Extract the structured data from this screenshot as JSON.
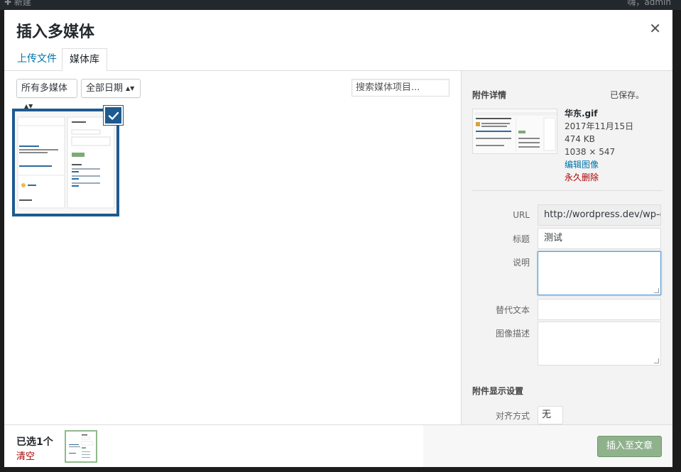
{
  "topbar": {
    "left": "✚ 新建",
    "right": "嗨，admin"
  },
  "modal": {
    "title": "插入多媒体",
    "close_icon": "close-icon"
  },
  "tabs": [
    {
      "label": "上传文件",
      "active": false
    },
    {
      "label": "媒体库",
      "active": true
    }
  ],
  "toolbar": {
    "type_filter": "所有多媒体",
    "date_filter": "全部日期",
    "search_placeholder": "搜索媒体项目..."
  },
  "attachment": {
    "selected": true,
    "check_icon": "checkmark-icon"
  },
  "details": {
    "heading": "附件详情",
    "saved": "已保存。",
    "filename": "华东.gif",
    "date": "2017年11月15日",
    "size": "474 KB",
    "dimensions": "1038 × 547",
    "edit_link": "编辑图像",
    "delete_link": "永久删除",
    "fields": {
      "url_label": "URL",
      "url_value": "http://wordpress.dev/wp-cc",
      "title_label": "标题",
      "title_value": "测试",
      "caption_label": "说明",
      "caption_value": "",
      "alt_label": "替代文本",
      "alt_value": "",
      "description_label": "图像描述",
      "description_value": ""
    },
    "display_heading": "附件显示设置",
    "align_label": "对齐方式",
    "align_value": "无"
  },
  "footer": {
    "selected_count": "已选1个",
    "clear": "清空",
    "insert_button": "插入至文章"
  },
  "colors": {
    "accent": "#0073aa",
    "selection": "#1e5a8f",
    "delete": "#aa0000",
    "insert": "#8fb28c"
  }
}
